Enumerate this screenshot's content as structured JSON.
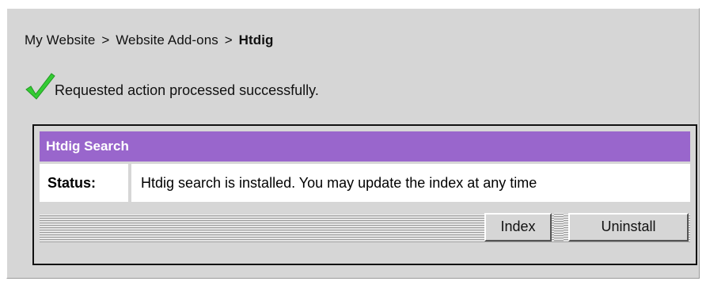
{
  "breadcrumb": {
    "items": [
      "My Website",
      "Website Add-ons"
    ],
    "separator": ">",
    "current": "Htdig"
  },
  "message": {
    "icon": "check-icon",
    "text": "Requested action processed successfully.",
    "icon_color": "#33cc33"
  },
  "panel": {
    "title": "Htdig Search",
    "header_color": "#9966cc",
    "status_label": "Status:",
    "status_value": "Htdig search is installed. You may update the index at any time"
  },
  "actions": {
    "index_label": "Index",
    "uninstall_label": "Uninstall"
  }
}
